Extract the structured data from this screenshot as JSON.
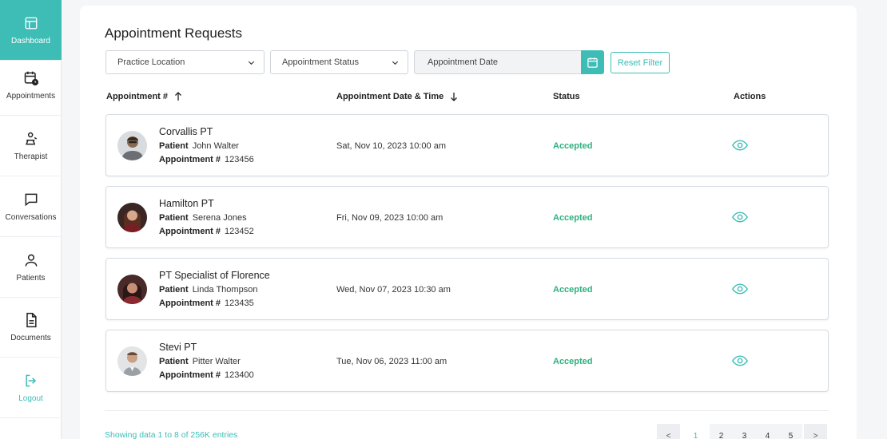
{
  "sidebar": {
    "items": [
      {
        "label": "Dashboard",
        "icon": "layout-icon"
      },
      {
        "label": "Appointments",
        "icon": "calendar-clock-icon"
      },
      {
        "label": "Therapist",
        "icon": "therapist-icon"
      },
      {
        "label": "Conversations",
        "icon": "chat-icon"
      },
      {
        "label": "Patients",
        "icon": "user-icon"
      },
      {
        "label": "Documents",
        "icon": "document-icon"
      },
      {
        "label": "Logout",
        "icon": "logout-icon"
      }
    ]
  },
  "page": {
    "title": "Appointment Requests"
  },
  "filters": {
    "location": "Practice Location",
    "status": "Appointment Status",
    "date": "Appointment Date",
    "reset": "Reset Filter"
  },
  "table": {
    "headers": {
      "appointment": "Appointment #",
      "datetime": "Appointment Date & Time",
      "status": "Status",
      "actions": "Actions"
    },
    "patient_label": "Patient",
    "appointment_label": "Appointment #",
    "rows": [
      {
        "clinic": "Corvallis PT",
        "patient": "John Walter",
        "number": "123456",
        "datetime": "Sat, Nov 10, 2023 10:00 am",
        "status": "Accepted"
      },
      {
        "clinic": "Hamilton PT",
        "patient": "Serena Jones",
        "number": "123452",
        "datetime": "Fri, Nov 09, 2023 10:00 am",
        "status": "Accepted"
      },
      {
        "clinic": "PT Specialist of Florence",
        "patient": "Linda Thompson",
        "number": "123435",
        "datetime": "Wed, Nov 07, 2023 10:30 am",
        "status": "Accepted"
      },
      {
        "clinic": "Stevi PT",
        "patient": "Pitter Walter",
        "number": "123400",
        "datetime": "Tue, Nov 06, 2023 11:00 am",
        "status": "Accepted"
      }
    ]
  },
  "footer": {
    "showing": "Showing data 1 to 8 of  256K entries",
    "pages": [
      "<",
      "1",
      "2",
      "3",
      "4",
      "5",
      ">"
    ],
    "current_page": "1"
  },
  "colors": {
    "accent": "#3dbdb6",
    "status_accepted": "#2fb07f"
  }
}
